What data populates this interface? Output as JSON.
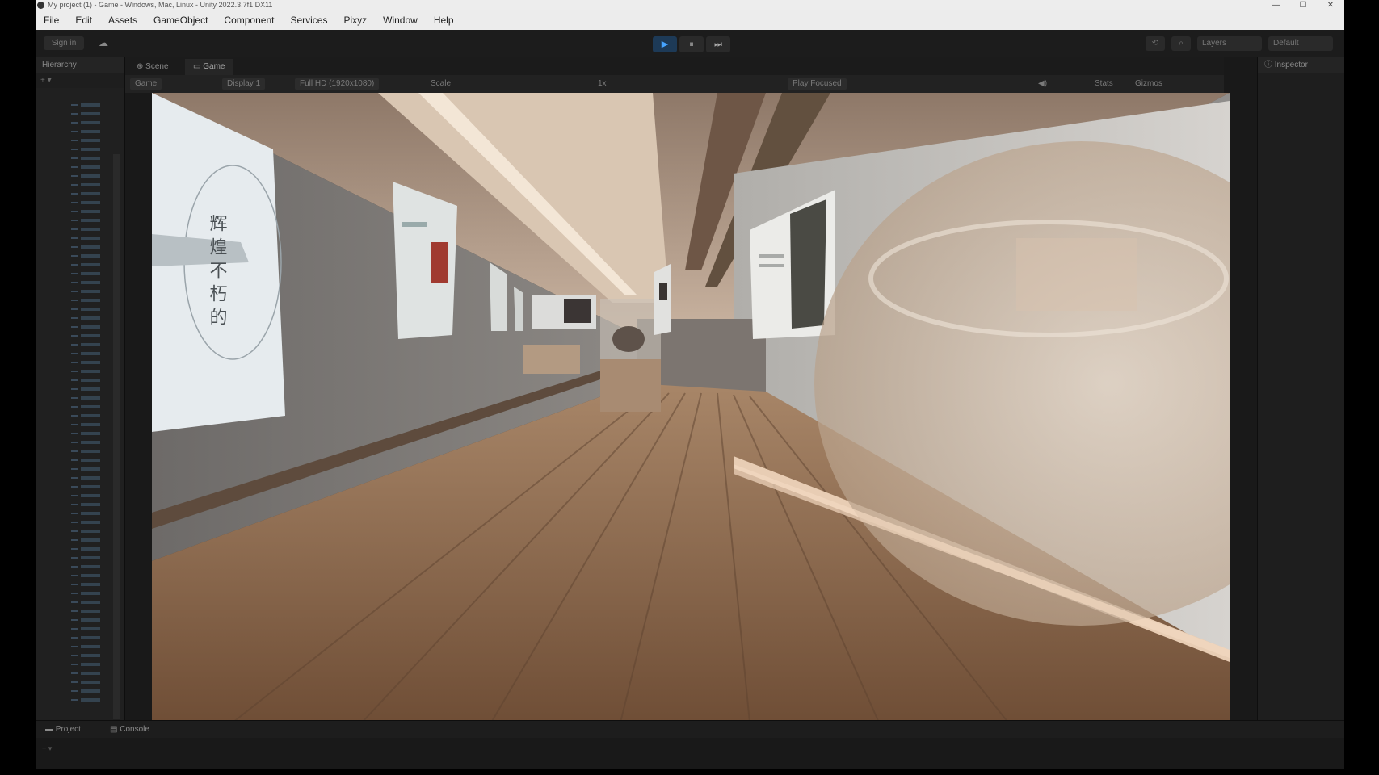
{
  "window": {
    "title": "My project (1) - Game - Windows, Mac, Linux - Unity 2022.3.7f1 DX11"
  },
  "menu": [
    "File",
    "Edit",
    "Assets",
    "GameObject",
    "Component",
    "Services",
    "Pixyz",
    "Window",
    "Help"
  ],
  "toolbar": {
    "account_label": "Sign in",
    "cloud_icon": "cloud-icon",
    "play_icon": "▶",
    "pause_icon": "⏸",
    "step_icon": "⏭",
    "layers_label": "Layers",
    "layout_label": "Default"
  },
  "hierarchy": {
    "tab_label": "Hierarchy"
  },
  "scene_tabs": {
    "scene_label": "Scene",
    "game_label": "Game"
  },
  "game_controls": {
    "display_mode": "Game",
    "display": "Display 1",
    "resolution": "Full HD (1920x1080)",
    "scale_label": "Scale",
    "scale_value": "1x",
    "play_focused": "Play Focused",
    "stats": "Stats",
    "gizmos": "Gizmos"
  },
  "inspector": {
    "tab_label": "Inspector"
  },
  "viewport": {
    "left_poster_text": "辉 煌 不 朽 的"
  },
  "bottom": {
    "project_label": "Project",
    "console_label": "Console"
  },
  "colors": {
    "play_active": "#46a4ff",
    "editor_bg": "#191919",
    "floor": "#7a5a42",
    "wall": "#7d7b7a"
  }
}
